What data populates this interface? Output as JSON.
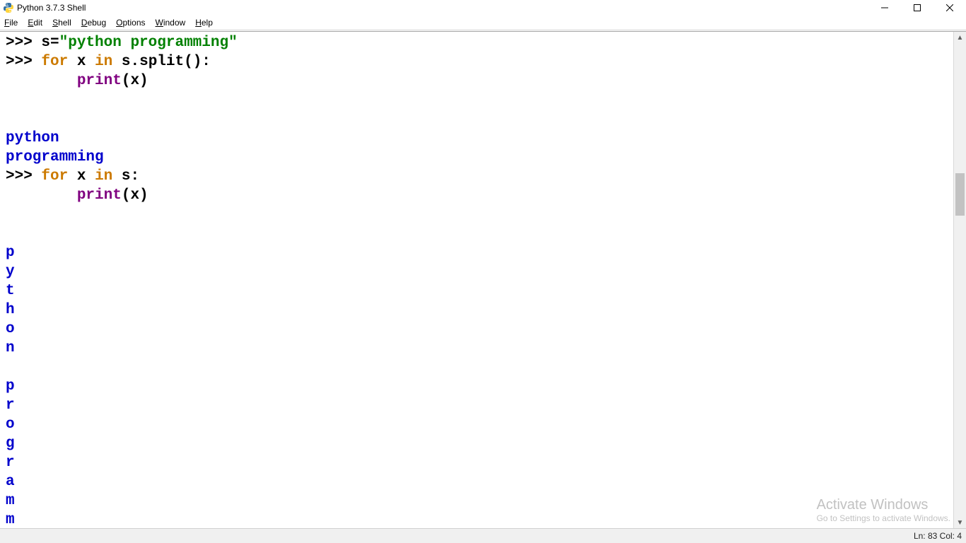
{
  "window": {
    "title": "Python 3.7.3 Shell"
  },
  "menu": {
    "items": [
      {
        "u": "F",
        "rest": "ile"
      },
      {
        "u": "E",
        "rest": "dit"
      },
      {
        "u": "S",
        "rest": "hell"
      },
      {
        "u": "D",
        "rest": "ebug"
      },
      {
        "u": "O",
        "rest": "ptions"
      },
      {
        "u": "W",
        "rest": "indow"
      },
      {
        "u": "H",
        "rest": "elp"
      }
    ]
  },
  "code": {
    "prompt": ">>> ",
    "indent": "        ",
    "l1_var": "s",
    "l1_eq": "=",
    "l1_str": "\"python programming\"",
    "l2_for": "for",
    "l2_sp1": " ",
    "l2_x": "x",
    "l2_sp2": " ",
    "l2_in": "in",
    "l2_sp3": " ",
    "l2_expr": "s.split():",
    "l3_print": "print",
    "l3_args": "(x)",
    "out1_a": "python",
    "out1_b": "programming",
    "l5_expr": "s:",
    "chars": [
      "p",
      "y",
      "t",
      "h",
      "o",
      "n",
      " ",
      "p",
      "r",
      "o",
      "g",
      "r",
      "a",
      "m",
      "m"
    ]
  },
  "status": {
    "text": "Ln: 83  Col: 4"
  },
  "watermark": {
    "l1": "Activate Windows",
    "l2": "Go to Settings to activate Windows."
  }
}
